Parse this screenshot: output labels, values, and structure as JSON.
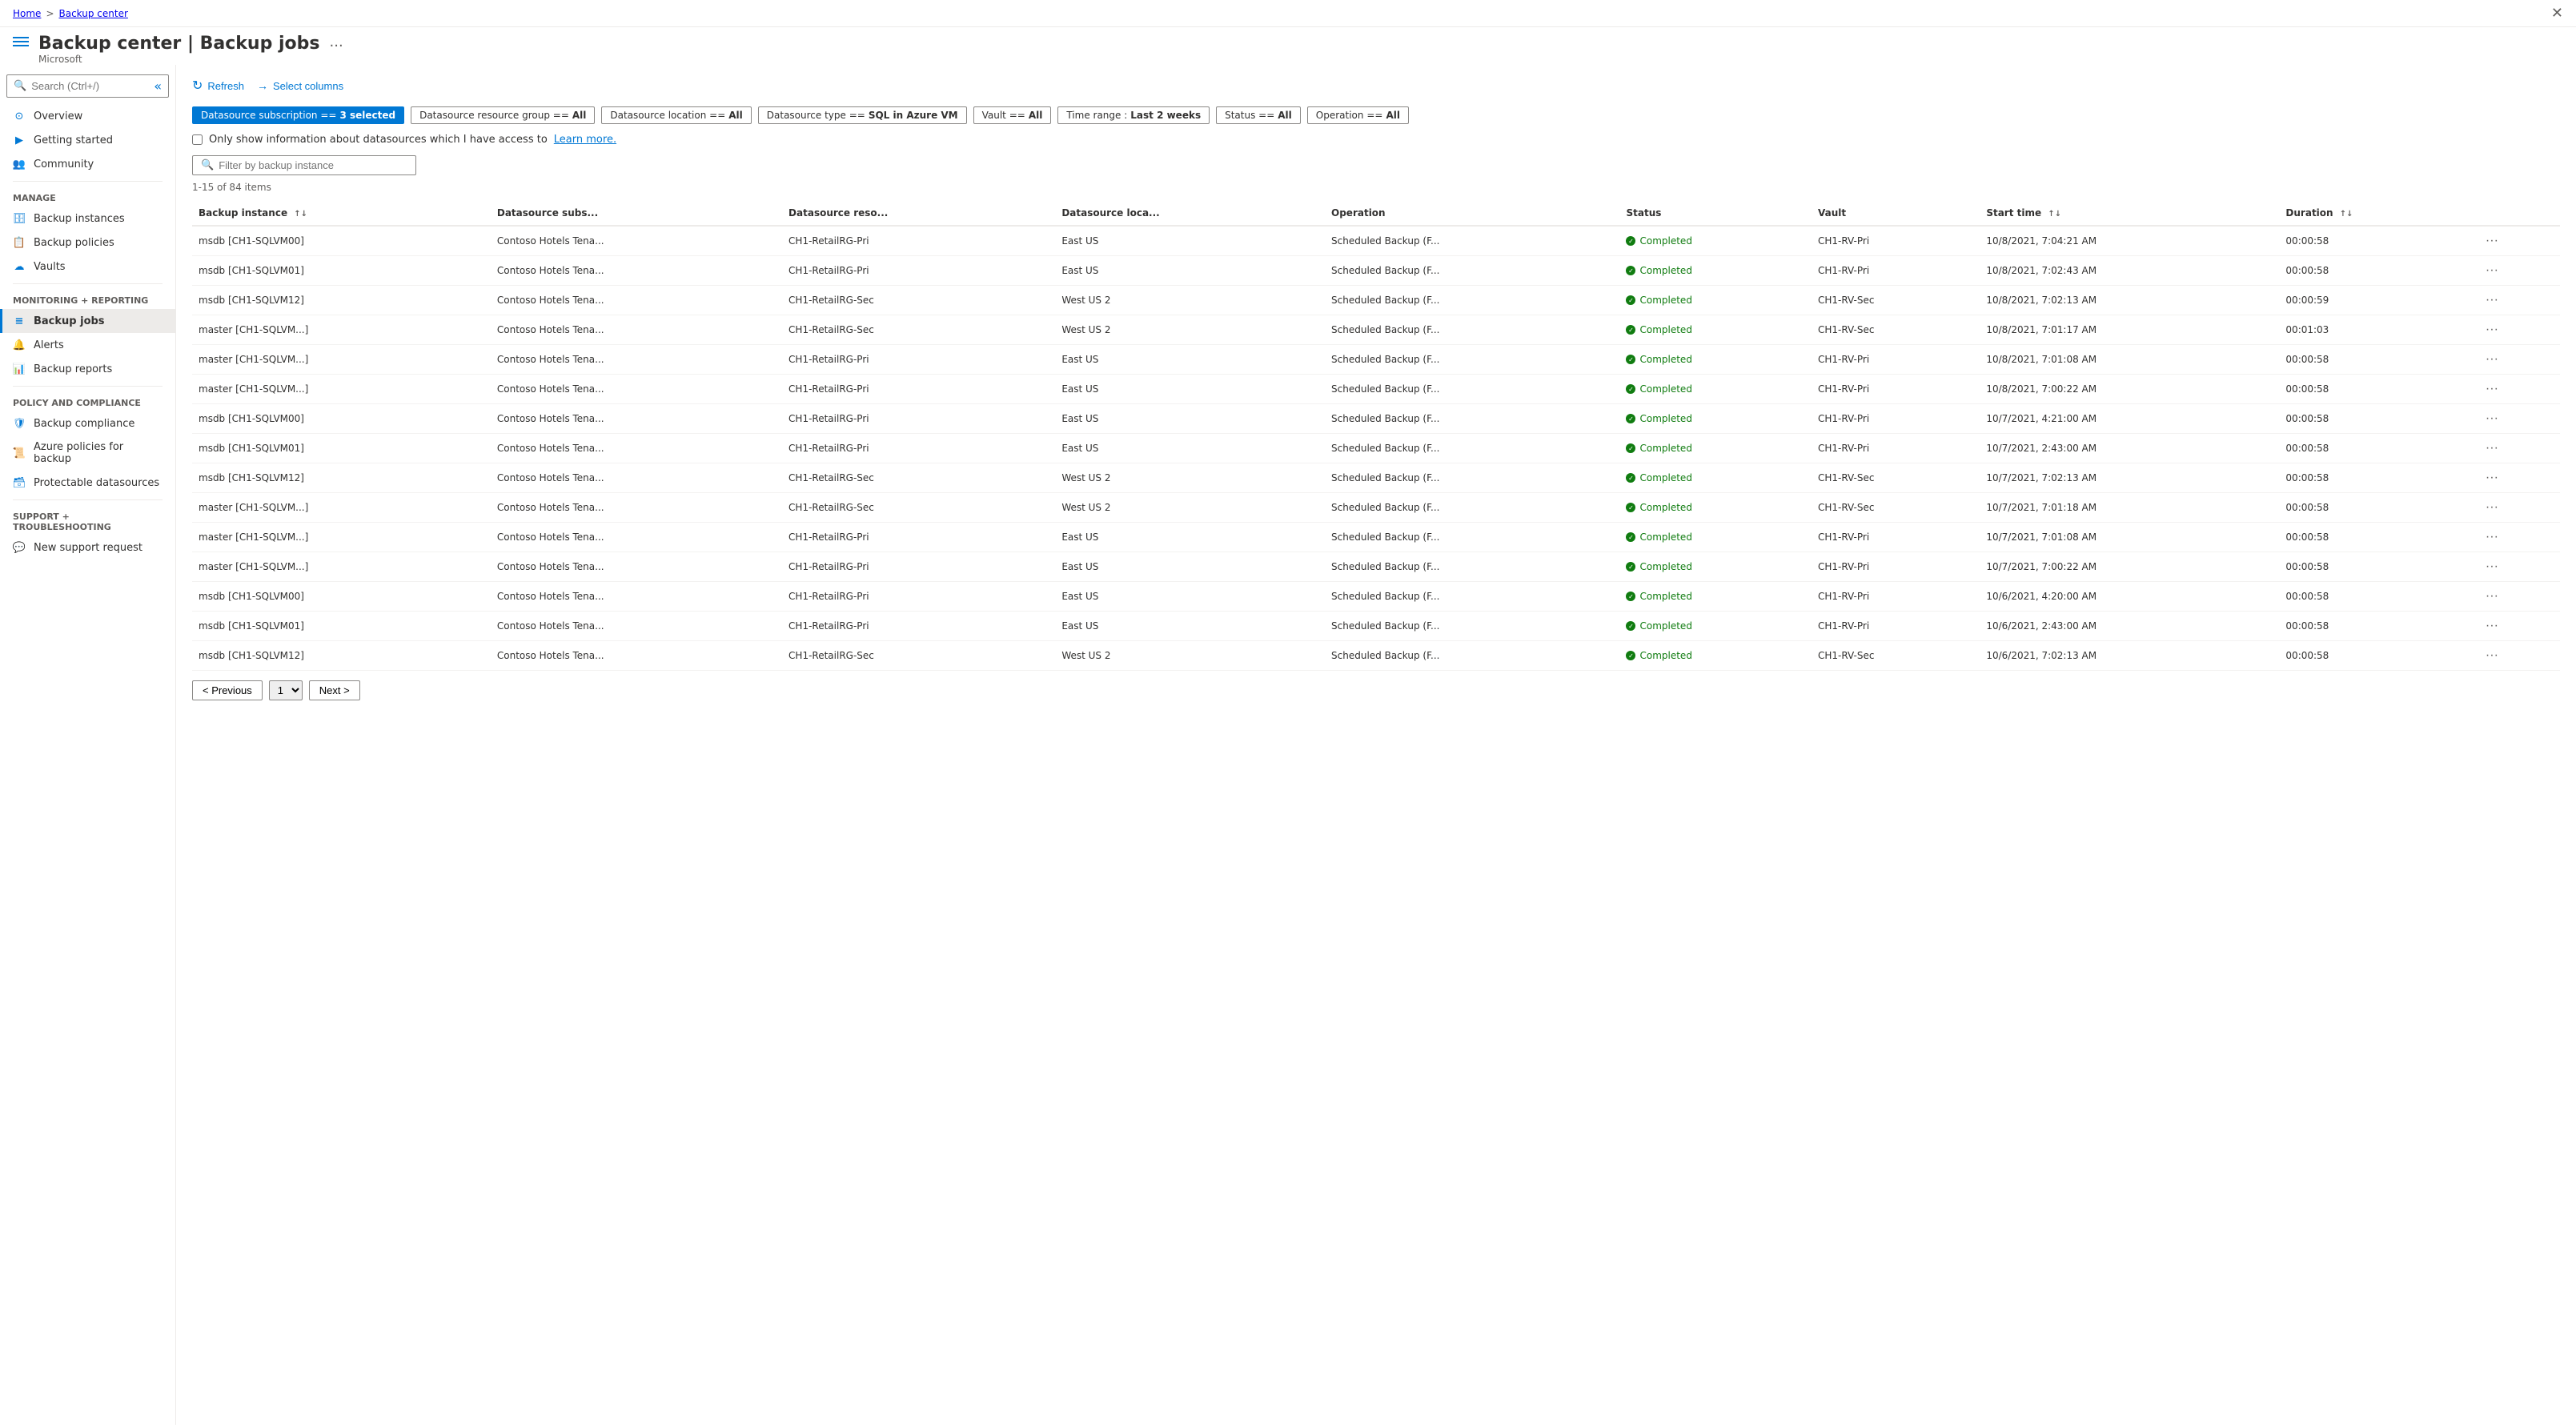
{
  "breadcrumb": {
    "home": "Home",
    "separator": ">",
    "current": "Backup center"
  },
  "header": {
    "title": "Backup center",
    "subtitle": "Backup jobs",
    "vendor": "Microsoft",
    "ellipsis": "..."
  },
  "search": {
    "placeholder": "Search (Ctrl+/)"
  },
  "toolbar": {
    "refresh": "Refresh",
    "select_columns": "Select columns"
  },
  "filters": [
    {
      "id": "subscription",
      "label": "Datasource subscription == 3 selected",
      "active": true
    },
    {
      "id": "resource_group",
      "label": "Datasource resource group == All",
      "active": false
    },
    {
      "id": "location",
      "label": "Datasource location == All",
      "active": false
    },
    {
      "id": "type",
      "label": "Datasource type == SQL in Azure VM",
      "active": false
    },
    {
      "id": "vault",
      "label": "Vault == All",
      "active": false
    },
    {
      "id": "time_range",
      "label": "Time range : Last 2 weeks",
      "active": false
    },
    {
      "id": "status",
      "label": "Status == All",
      "active": false
    },
    {
      "id": "operation",
      "label": "Operation == All",
      "active": false
    }
  ],
  "checkbox": {
    "label": "Only show information about datasources which I have access to",
    "link_text": "Learn more."
  },
  "filter_input": {
    "placeholder": "Filter by backup instance"
  },
  "count": "1-15 of 84 items",
  "table": {
    "columns": [
      {
        "id": "backup_instance",
        "label": "Backup instance",
        "sortable": true
      },
      {
        "id": "datasource_subs",
        "label": "Datasource subs...",
        "sortable": false
      },
      {
        "id": "datasource_reso",
        "label": "Datasource reso...",
        "sortable": false
      },
      {
        "id": "datasource_loca",
        "label": "Datasource loca...",
        "sortable": false
      },
      {
        "id": "operation",
        "label": "Operation",
        "sortable": false
      },
      {
        "id": "status",
        "label": "Status",
        "sortable": false
      },
      {
        "id": "vault",
        "label": "Vault",
        "sortable": false
      },
      {
        "id": "start_time",
        "label": "Start time",
        "sortable": true
      },
      {
        "id": "duration",
        "label": "Duration",
        "sortable": true
      },
      {
        "id": "actions",
        "label": "",
        "sortable": false
      }
    ],
    "rows": [
      {
        "backup_instance": "msdb [CH1-SQLVM00]",
        "datasource_subs": "Contoso Hotels Tena...",
        "datasource_reso": "CH1-RetailRG-Pri",
        "datasource_loca": "East US",
        "operation": "Scheduled Backup (F...",
        "status": "Completed",
        "vault": "CH1-RV-Pri",
        "start_time": "10/8/2021, 7:04:21 AM",
        "duration": "00:00:58"
      },
      {
        "backup_instance": "msdb [CH1-SQLVM01]",
        "datasource_subs": "Contoso Hotels Tena...",
        "datasource_reso": "CH1-RetailRG-Pri",
        "datasource_loca": "East US",
        "operation": "Scheduled Backup (F...",
        "status": "Completed",
        "vault": "CH1-RV-Pri",
        "start_time": "10/8/2021, 7:02:43 AM",
        "duration": "00:00:58"
      },
      {
        "backup_instance": "msdb [CH1-SQLVM12]",
        "datasource_subs": "Contoso Hotels Tena...",
        "datasource_reso": "CH1-RetailRG-Sec",
        "datasource_loca": "West US 2",
        "operation": "Scheduled Backup (F...",
        "status": "Completed",
        "vault": "CH1-RV-Sec",
        "start_time": "10/8/2021, 7:02:13 AM",
        "duration": "00:00:59"
      },
      {
        "backup_instance": "master [CH1-SQLVM...]",
        "datasource_subs": "Contoso Hotels Tena...",
        "datasource_reso": "CH1-RetailRG-Sec",
        "datasource_loca": "West US 2",
        "operation": "Scheduled Backup (F...",
        "status": "Completed",
        "vault": "CH1-RV-Sec",
        "start_time": "10/8/2021, 7:01:17 AM",
        "duration": "00:01:03"
      },
      {
        "backup_instance": "master [CH1-SQLVM...]",
        "datasource_subs": "Contoso Hotels Tena...",
        "datasource_reso": "CH1-RetailRG-Pri",
        "datasource_loca": "East US",
        "operation": "Scheduled Backup (F...",
        "status": "Completed",
        "vault": "CH1-RV-Pri",
        "start_time": "10/8/2021, 7:01:08 AM",
        "duration": "00:00:58"
      },
      {
        "backup_instance": "master [CH1-SQLVM...]",
        "datasource_subs": "Contoso Hotels Tena...",
        "datasource_reso": "CH1-RetailRG-Pri",
        "datasource_loca": "East US",
        "operation": "Scheduled Backup (F...",
        "status": "Completed",
        "vault": "CH1-RV-Pri",
        "start_time": "10/8/2021, 7:00:22 AM",
        "duration": "00:00:58"
      },
      {
        "backup_instance": "msdb [CH1-SQLVM00]",
        "datasource_subs": "Contoso Hotels Tena...",
        "datasource_reso": "CH1-RetailRG-Pri",
        "datasource_loca": "East US",
        "operation": "Scheduled Backup (F...",
        "status": "Completed",
        "vault": "CH1-RV-Pri",
        "start_time": "10/7/2021, 4:21:00 AM",
        "duration": "00:00:58"
      },
      {
        "backup_instance": "msdb [CH1-SQLVM01]",
        "datasource_subs": "Contoso Hotels Tena...",
        "datasource_reso": "CH1-RetailRG-Pri",
        "datasource_loca": "East US",
        "operation": "Scheduled Backup (F...",
        "status": "Completed",
        "vault": "CH1-RV-Pri",
        "start_time": "10/7/2021, 2:43:00 AM",
        "duration": "00:00:58"
      },
      {
        "backup_instance": "msdb [CH1-SQLVM12]",
        "datasource_subs": "Contoso Hotels Tena...",
        "datasource_reso": "CH1-RetailRG-Sec",
        "datasource_loca": "West US 2",
        "operation": "Scheduled Backup (F...",
        "status": "Completed",
        "vault": "CH1-RV-Sec",
        "start_time": "10/7/2021, 7:02:13 AM",
        "duration": "00:00:58"
      },
      {
        "backup_instance": "master [CH1-SQLVM...]",
        "datasource_subs": "Contoso Hotels Tena...",
        "datasource_reso": "CH1-RetailRG-Sec",
        "datasource_loca": "West US 2",
        "operation": "Scheduled Backup (F...",
        "status": "Completed",
        "vault": "CH1-RV-Sec",
        "start_time": "10/7/2021, 7:01:18 AM",
        "duration": "00:00:58"
      },
      {
        "backup_instance": "master [CH1-SQLVM...]",
        "datasource_subs": "Contoso Hotels Tena...",
        "datasource_reso": "CH1-RetailRG-Pri",
        "datasource_loca": "East US",
        "operation": "Scheduled Backup (F...",
        "status": "Completed",
        "vault": "CH1-RV-Pri",
        "start_time": "10/7/2021, 7:01:08 AM",
        "duration": "00:00:58"
      },
      {
        "backup_instance": "master [CH1-SQLVM...]",
        "datasource_subs": "Contoso Hotels Tena...",
        "datasource_reso": "CH1-RetailRG-Pri",
        "datasource_loca": "East US",
        "operation": "Scheduled Backup (F...",
        "status": "Completed",
        "vault": "CH1-RV-Pri",
        "start_time": "10/7/2021, 7:00:22 AM",
        "duration": "00:00:58"
      },
      {
        "backup_instance": "msdb [CH1-SQLVM00]",
        "datasource_subs": "Contoso Hotels Tena...",
        "datasource_reso": "CH1-RetailRG-Pri",
        "datasource_loca": "East US",
        "operation": "Scheduled Backup (F...",
        "status": "Completed",
        "vault": "CH1-RV-Pri",
        "start_time": "10/6/2021, 4:20:00 AM",
        "duration": "00:00:58"
      },
      {
        "backup_instance": "msdb [CH1-SQLVM01]",
        "datasource_subs": "Contoso Hotels Tena...",
        "datasource_reso": "CH1-RetailRG-Pri",
        "datasource_loca": "East US",
        "operation": "Scheduled Backup (F...",
        "status": "Completed",
        "vault": "CH1-RV-Pri",
        "start_time": "10/6/2021, 2:43:00 AM",
        "duration": "00:00:58"
      },
      {
        "backup_instance": "msdb [CH1-SQLVM12]",
        "datasource_subs": "Contoso Hotels Tena...",
        "datasource_reso": "CH1-RetailRG-Sec",
        "datasource_loca": "West US 2",
        "operation": "Scheduled Backup (F...",
        "status": "Completed",
        "vault": "CH1-RV-Sec",
        "start_time": "10/6/2021, 7:02:13 AM",
        "duration": "00:00:58"
      }
    ]
  },
  "pagination": {
    "previous": "< Previous",
    "next": "Next >",
    "page": "1"
  },
  "sidebar": {
    "collapse_label": "«",
    "items": [
      {
        "id": "overview",
        "label": "Overview",
        "icon": "overview-icon",
        "section": ""
      },
      {
        "id": "getting-started",
        "label": "Getting started",
        "icon": "getting-started-icon",
        "section": ""
      },
      {
        "id": "community",
        "label": "Community",
        "icon": "community-icon",
        "section": ""
      },
      {
        "id": "manage",
        "label": "Manage",
        "section": "manage",
        "is_section": true
      },
      {
        "id": "backup-instances",
        "label": "Backup instances",
        "icon": "backup-instances-icon",
        "section": "manage"
      },
      {
        "id": "backup-policies",
        "label": "Backup policies",
        "icon": "backup-policies-icon",
        "section": "manage"
      },
      {
        "id": "vaults",
        "label": "Vaults",
        "icon": "vaults-icon",
        "section": "manage"
      },
      {
        "id": "monitoring",
        "label": "Monitoring + reporting",
        "section": "monitoring",
        "is_section": true
      },
      {
        "id": "backup-jobs",
        "label": "Backup jobs",
        "icon": "backup-jobs-icon",
        "section": "monitoring",
        "active": true
      },
      {
        "id": "alerts",
        "label": "Alerts",
        "icon": "alerts-icon",
        "section": "monitoring"
      },
      {
        "id": "backup-reports",
        "label": "Backup reports",
        "icon": "backup-reports-icon",
        "section": "monitoring"
      },
      {
        "id": "policy-compliance",
        "label": "Policy and compliance",
        "section": "policy",
        "is_section": true
      },
      {
        "id": "backup-compliance",
        "label": "Backup compliance",
        "icon": "backup-compliance-icon",
        "section": "policy"
      },
      {
        "id": "azure-policies",
        "label": "Azure policies for backup",
        "icon": "azure-policies-icon",
        "section": "policy"
      },
      {
        "id": "protectable-datasources",
        "label": "Protectable datasources",
        "icon": "protectable-icon",
        "section": "policy"
      },
      {
        "id": "support",
        "label": "Support + troubleshooting",
        "section": "support",
        "is_section": true
      },
      {
        "id": "new-support",
        "label": "New support request",
        "icon": "support-icon",
        "section": "support"
      }
    ]
  }
}
